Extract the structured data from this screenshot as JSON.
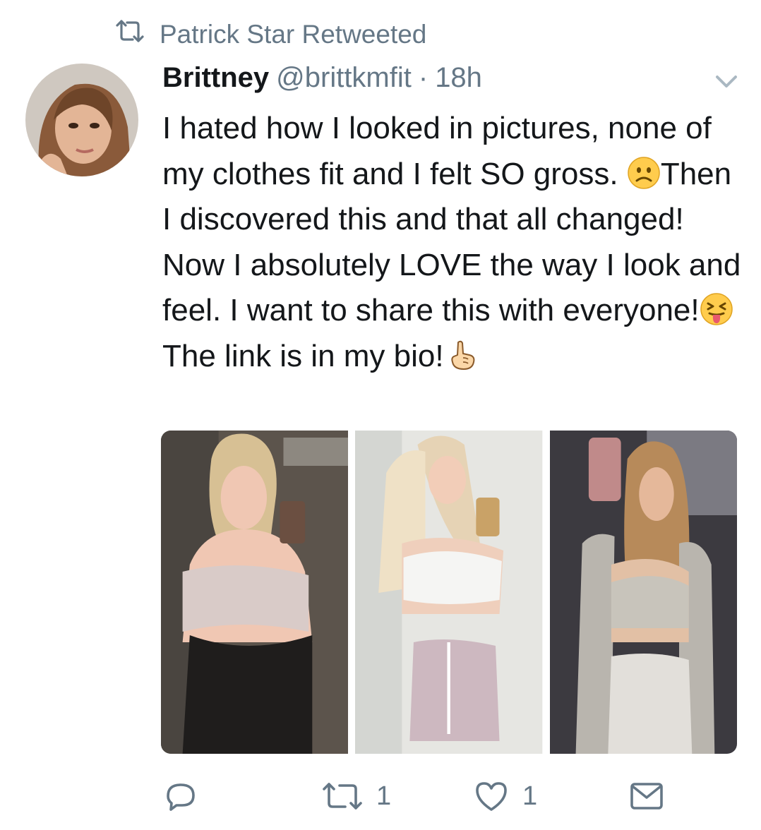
{
  "retweet": {
    "label": "Patrick Star Retweeted"
  },
  "tweet": {
    "author_name": "Brittney",
    "handle": "@brittkmfit",
    "separator": "·",
    "time": "18h",
    "text_part1": "I hated how I looked in pictures, none of my clothes fit and I felt SO gross. ",
    "text_part2": "Then I discovered this and that all changed! Now I absolutely LOVE the way I look and feel. I want to share this with everyone!",
    "text_part3": "The link is in my bio!",
    "emoji_1": "frowning-face",
    "emoji_2": "squinting-face-with-tongue",
    "emoji_3": "backhand-index-pointing-up"
  },
  "actions": {
    "reply_count": "",
    "retweet_count": "1",
    "like_count": "1"
  },
  "colors": {
    "text": "#14171a",
    "secondary": "#657786"
  }
}
